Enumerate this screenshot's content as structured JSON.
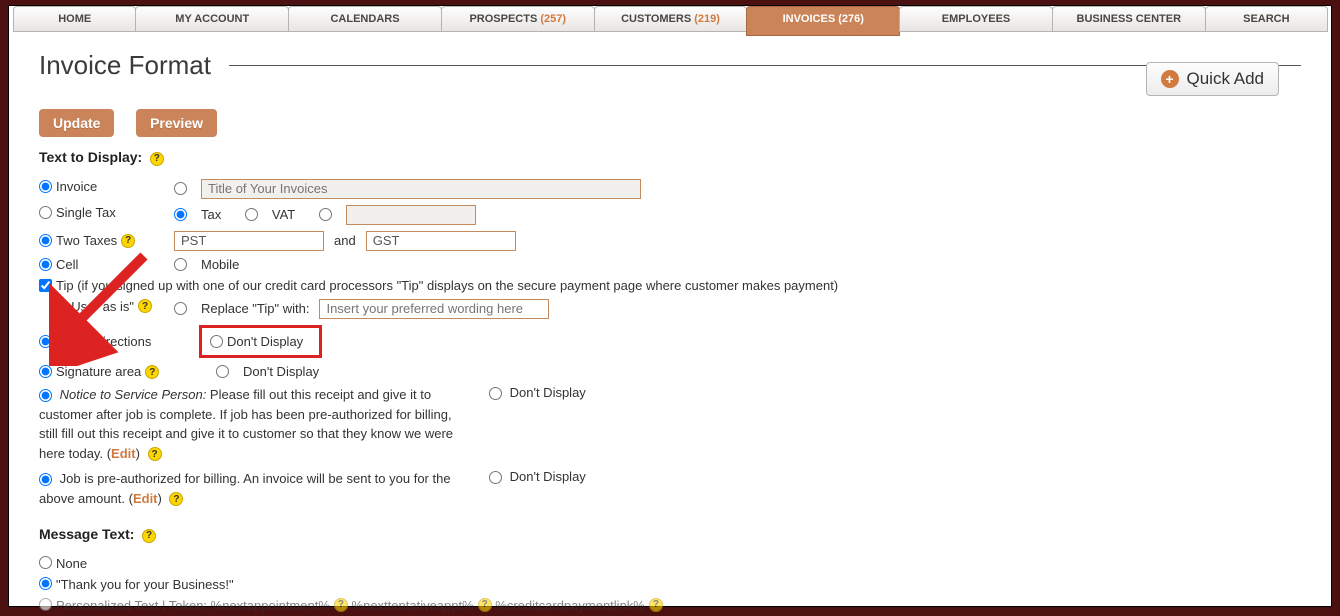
{
  "tabs": {
    "home": "HOME",
    "account": "MY ACCOUNT",
    "calendars": "CALENDARS",
    "prospects": "PROSPECTS",
    "prospects_count": "(257)",
    "customers": "CUSTOMERS",
    "customers_count": "(219)",
    "invoices": "INVOICES",
    "invoices_count": "(276)",
    "employees": "EMPLOYEES",
    "business": "BUSINESS CENTER",
    "search": "SEARCH"
  },
  "quickadd": "Quick Add",
  "page_title": "Invoice Format",
  "buttons": {
    "update": "Update",
    "preview": "Preview"
  },
  "section1_label": "Text to Display:",
  "invoice_label": "Invoice",
  "invoice_title_placeholder": "Title of Your Invoices",
  "single_tax_label": "Single Tax",
  "tax_label": "Tax",
  "vat_label": "VAT",
  "two_taxes_label": "Two Taxes",
  "tax1_value": "PST",
  "and_label": "and",
  "tax2_value": "GST",
  "cell_label": "Cell",
  "mobile_label": "Mobile",
  "tip_label": "Tip (if you signed up with one of our credit card processors \"Tip\" displays on the secure payment page where customer makes payment)",
  "tip_asis": "Use \"as is\"",
  "tip_replace": "Replace \"Tip\" with:",
  "tip_replace_placeholder": "Insert your preferred wording here",
  "notes_label": "Notes/Directions",
  "dont_display": "Don't Display",
  "signature_label": "Signature area",
  "notice_lead": "Notice to Service Person: ",
  "notice_text": "Please fill out this receipt and give it to customer after job is complete. If job has been pre-authorized for billing, still fill out this receipt and give it to customer so that they know we were here today. (",
  "edit": "Edit",
  "preauth_text": "Job is pre-authorized for billing. An invoice will be sent to you for the above amount. (",
  "section2_label": "Message Text:",
  "msg_none": "None",
  "msg_thanks": "\"Thank you for your Business!\"",
  "msg_personal": "Personalized Text |  Token: %nextappointment%",
  "token2": "%nexttentativeappt%",
  "token3": "%creditcardpaymentlink%"
}
